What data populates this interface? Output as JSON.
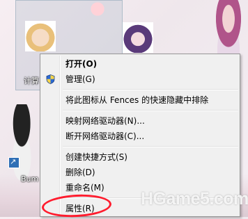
{
  "desktop": {
    "icon_label_1": "计算",
    "shortcut_label": "Bum"
  },
  "context_menu": {
    "items": [
      {
        "label": "打开(O)",
        "bold": true
      },
      {
        "label": "管理(G)",
        "icon": "uac-shield-icon"
      },
      {
        "label": "将此图标从 Fences 的快速隐藏中排除"
      },
      {
        "label": "映射网络驱动器(N)..."
      },
      {
        "label": "断开网络驱动器(C)..."
      },
      {
        "label": "创建快捷方式(S)"
      },
      {
        "label": "删除(D)"
      },
      {
        "label": "重命名(M)"
      },
      {
        "label": "属性(R)"
      }
    ]
  },
  "watermark": "HGame5.com",
  "colors": {
    "menu_bg": "#f0f0f0",
    "highlight_circle": "#ff1c2e"
  }
}
